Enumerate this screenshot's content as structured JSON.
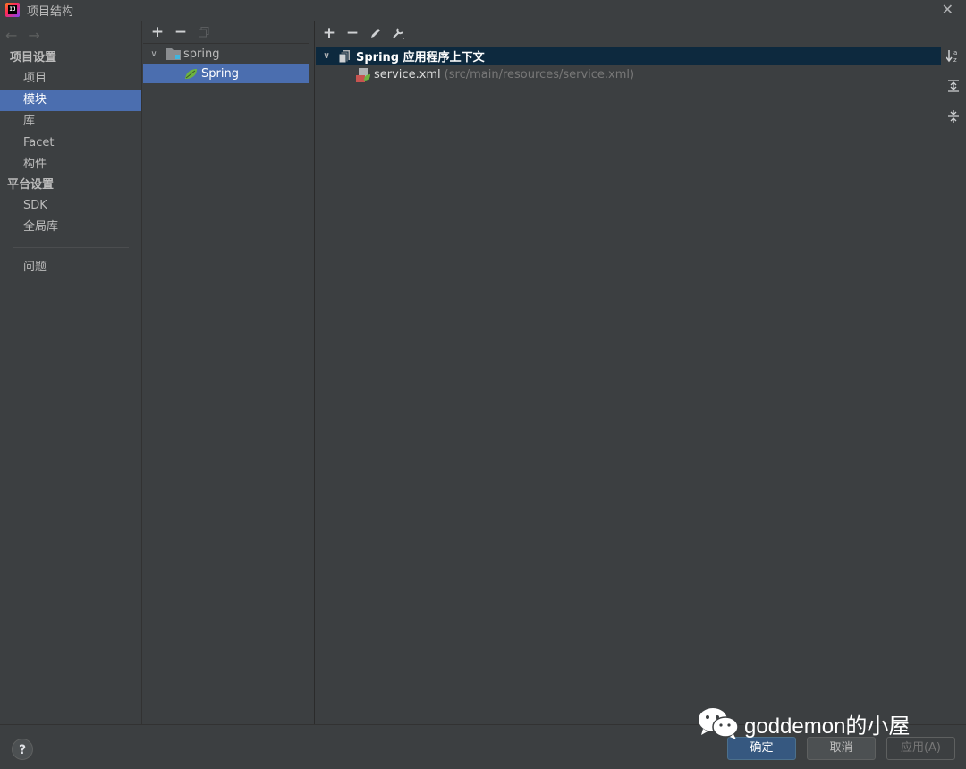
{
  "window": {
    "title": "项目结构"
  },
  "nav": {
    "sections": [
      {
        "label": "项目设置",
        "items": [
          "项目",
          "模块",
          "库",
          "Facet",
          "构件"
        ]
      },
      {
        "label": "平台设置",
        "items": [
          "SDK",
          "全局库"
        ]
      }
    ],
    "extra_item": "问题",
    "selected": "模块"
  },
  "modules": {
    "root": "spring",
    "child": "Spring"
  },
  "context": {
    "title": "Spring 应用程序上下文",
    "file_name": "service.xml",
    "file_path": "(src/main/resources/service.xml)"
  },
  "buttons": {
    "ok": "确定",
    "cancel": "取消",
    "apply": "应用(A)",
    "help": "?"
  },
  "watermark": "goddemon的小屋",
  "colors": {
    "selection": "#4b6eaf",
    "context_header": "#0d293e",
    "spring_green": "#6db33f",
    "primary_button": "#365880"
  }
}
